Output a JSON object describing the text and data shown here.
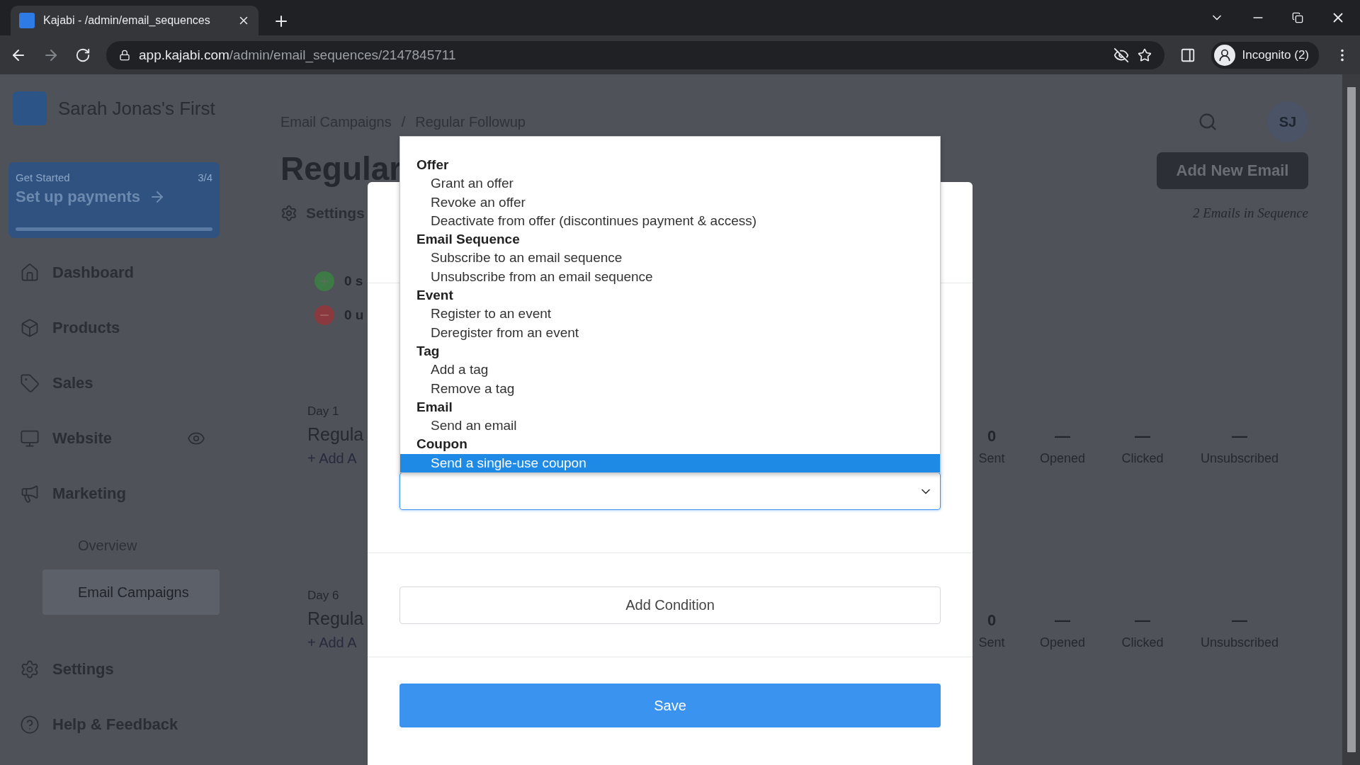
{
  "browser": {
    "tab_title": "Kajabi - /admin/email_sequences",
    "url_host": "app.kajabi.com",
    "url_path": "/admin/email_sequences/2147845711",
    "profile": "Incognito (2)"
  },
  "sidebar": {
    "brand": "Sarah Jonas's First",
    "get_started": {
      "label": "Get Started",
      "count": "3/4",
      "title": "Set up payments"
    },
    "items": [
      {
        "label": "Dashboard",
        "kind": "dashboard"
      },
      {
        "label": "Products",
        "kind": "products"
      },
      {
        "label": "Sales",
        "kind": "sales"
      },
      {
        "label": "Website",
        "kind": "website"
      },
      {
        "label": "Marketing",
        "kind": "marketing",
        "children": [
          {
            "label": "Overview",
            "selected": false
          },
          {
            "label": "Email Campaigns",
            "selected": true
          }
        ]
      }
    ],
    "footer": [
      {
        "label": "Settings",
        "kind": "settings"
      },
      {
        "label": "Help & Feedback",
        "kind": "help"
      }
    ]
  },
  "main": {
    "breadcrumb": [
      "Email Campaigns",
      "Regular Followup"
    ],
    "breadcrumb_separator": "/",
    "avatar": "SJ",
    "title": "Regular",
    "add_button": "Add New Email",
    "settings": "Settings",
    "email_count": "2 Emails in Sequence",
    "subscribers": [
      {
        "kind": "add",
        "text": "0 s"
      },
      {
        "kind": "remove",
        "text": "0 u"
      }
    ],
    "emails": [
      {
        "day": "Day 1",
        "name": "Regula",
        "add_link": "+ Add A",
        "stats": [
          {
            "value": "0",
            "label": "Sent"
          },
          {
            "value": "—",
            "label": "Opened"
          },
          {
            "value": "—",
            "label": "Clicked"
          },
          {
            "value": "—",
            "label": "Unsubscribed"
          }
        ]
      },
      {
        "day": "Day 6",
        "name": "Regula",
        "add_link": "+ Add A",
        "stats": [
          {
            "value": "0",
            "label": "Sent"
          },
          {
            "value": "—",
            "label": "Opened"
          },
          {
            "value": "—",
            "label": "Clicked"
          },
          {
            "value": "—",
            "label": "Unsubscribed"
          }
        ]
      }
    ]
  },
  "modal": {
    "dropdown": [
      {
        "label": "Offer",
        "options": [
          {
            "label": "Grant an offer",
            "selected": false
          },
          {
            "label": "Revoke an offer",
            "selected": false
          },
          {
            "label": "Deactivate from offer (discontinues payment & access)",
            "selected": false
          }
        ]
      },
      {
        "label": "Email Sequence",
        "options": [
          {
            "label": "Subscribe to an email sequence",
            "selected": false
          },
          {
            "label": "Unsubscribe from an email sequence",
            "selected": false
          }
        ]
      },
      {
        "label": "Event",
        "options": [
          {
            "label": "Register to an event",
            "selected": false
          },
          {
            "label": "Deregister from an event",
            "selected": false
          }
        ]
      },
      {
        "label": "Tag",
        "options": [
          {
            "label": "Add a tag",
            "selected": false
          },
          {
            "label": "Remove a tag",
            "selected": false
          }
        ]
      },
      {
        "label": "Email",
        "options": [
          {
            "label": "Send an email",
            "selected": false
          }
        ]
      },
      {
        "label": "Coupon",
        "options": [
          {
            "label": "Send a single-use coupon",
            "selected": true
          }
        ]
      }
    ],
    "add_condition": "Add Condition",
    "save": "Save"
  }
}
